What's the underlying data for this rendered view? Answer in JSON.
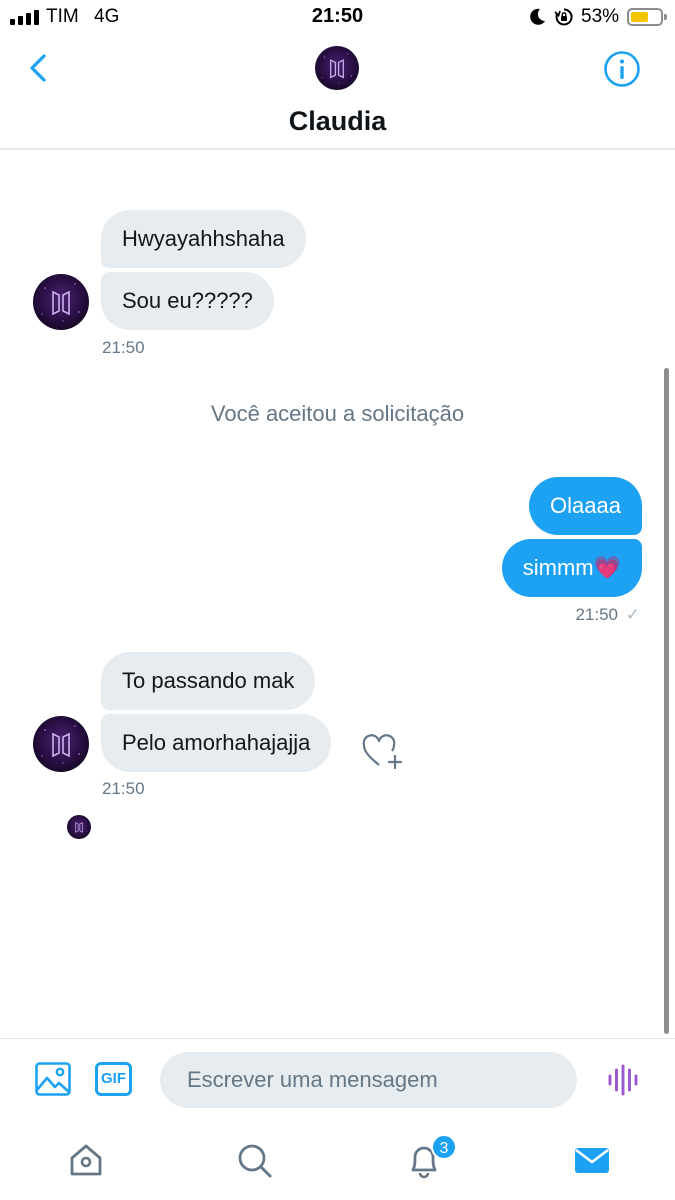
{
  "status_bar": {
    "carrier": "TIM",
    "network": "4G",
    "time": "21:50",
    "battery_percent": "53%",
    "battery_level": 0.53,
    "icons": [
      "signal-bars-icon",
      "moon-icon",
      "rotation-lock-icon",
      "battery-icon"
    ]
  },
  "header": {
    "contact_name": "Claudia",
    "icons": [
      "back-chevron-icon",
      "contact-avatar",
      "info-icon"
    ]
  },
  "conversation": {
    "incoming_group_1": {
      "messages": [
        "Hwyayahhshaha",
        "Sou eu?????"
      ],
      "time": "21:50"
    },
    "system_note": "Você aceitou a solicitação",
    "outgoing_group": {
      "messages": [
        "Olaaaa",
        "simmm💗"
      ],
      "time": "21:50",
      "status": "✓"
    },
    "incoming_group_2": {
      "messages": [
        "To passando mak",
        "Pelo amorhahajajja"
      ],
      "time": "21:50"
    }
  },
  "composer": {
    "placeholder": "Escrever uma mensagem",
    "gif_label": "GIF",
    "icons": [
      "image-icon",
      "gif-icon",
      "voice-icon"
    ]
  },
  "tab_bar": {
    "notifications_badge": "3",
    "icons": [
      "home-icon",
      "search-icon",
      "notifications-bell-icon",
      "messages-mail-icon"
    ]
  },
  "colors": {
    "accent": "#1da1f2",
    "incoming_bubble": "#e6ecf0",
    "muted_text": "#657786",
    "voice_icon": "#9b59d0"
  }
}
